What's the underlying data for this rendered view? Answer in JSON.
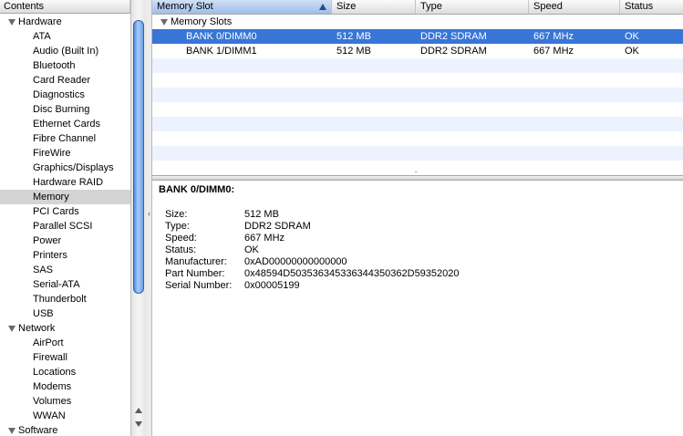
{
  "sidebar": {
    "header": "Contents",
    "rows": [
      {
        "kind": "group",
        "label": "Hardware"
      },
      {
        "kind": "item",
        "label": "ATA"
      },
      {
        "kind": "item",
        "label": "Audio (Built In)"
      },
      {
        "kind": "item",
        "label": "Bluetooth"
      },
      {
        "kind": "item",
        "label": "Card Reader"
      },
      {
        "kind": "item",
        "label": "Diagnostics"
      },
      {
        "kind": "item",
        "label": "Disc Burning"
      },
      {
        "kind": "item",
        "label": "Ethernet Cards"
      },
      {
        "kind": "item",
        "label": "Fibre Channel"
      },
      {
        "kind": "item",
        "label": "FireWire"
      },
      {
        "kind": "item",
        "label": "Graphics/Displays"
      },
      {
        "kind": "item",
        "label": "Hardware RAID"
      },
      {
        "kind": "item",
        "label": "Memory",
        "selected": true
      },
      {
        "kind": "item",
        "label": "PCI Cards"
      },
      {
        "kind": "item",
        "label": "Parallel SCSI"
      },
      {
        "kind": "item",
        "label": "Power"
      },
      {
        "kind": "item",
        "label": "Printers"
      },
      {
        "kind": "item",
        "label": "SAS"
      },
      {
        "kind": "item",
        "label": "Serial-ATA"
      },
      {
        "kind": "item",
        "label": "Thunderbolt"
      },
      {
        "kind": "item",
        "label": "USB"
      },
      {
        "kind": "group",
        "label": "Network"
      },
      {
        "kind": "item",
        "label": "AirPort"
      },
      {
        "kind": "item",
        "label": "Firewall"
      },
      {
        "kind": "item",
        "label": "Locations"
      },
      {
        "kind": "item",
        "label": "Modems"
      },
      {
        "kind": "item",
        "label": "Volumes"
      },
      {
        "kind": "item",
        "label": "WWAN"
      },
      {
        "kind": "group",
        "label": "Software"
      }
    ]
  },
  "table": {
    "columns": [
      "Memory Slot",
      "Size",
      "Type",
      "Speed",
      "Status"
    ],
    "group_label": "Memory Slots",
    "rows": [
      {
        "slot": "BANK 0/DIMM0",
        "size": "512 MB",
        "type": "DDR2 SDRAM",
        "speed": "667 MHz",
        "status": "OK",
        "selected": true
      },
      {
        "slot": "BANK 1/DIMM1",
        "size": "512 MB",
        "type": "DDR2 SDRAM",
        "speed": "667 MHz",
        "status": "OK"
      }
    ]
  },
  "detail": {
    "title": "BANK 0/DIMM0:",
    "properties": [
      {
        "key": "Size:",
        "value": "512 MB"
      },
      {
        "key": "Type:",
        "value": "DDR2 SDRAM"
      },
      {
        "key": "Speed:",
        "value": "667 MHz"
      },
      {
        "key": "Status:",
        "value": "OK"
      },
      {
        "key": "Manufacturer:",
        "value": "0xAD00000000000000"
      },
      {
        "key": "Part Number:",
        "value": "0x48594D503536345336344350362D59352020"
      },
      {
        "key": "Serial Number:",
        "value": "0x00005199"
      }
    ]
  },
  "colors": {
    "selection": "#3875d7",
    "sidebar_selection": "#d4d4d4",
    "stripe": "#edf3fe",
    "scroll_thumb": "#5e96e8"
  },
  "icons": {
    "sort": "sort-ascending-icon",
    "disclosure": "disclosure-triangle-icon"
  }
}
